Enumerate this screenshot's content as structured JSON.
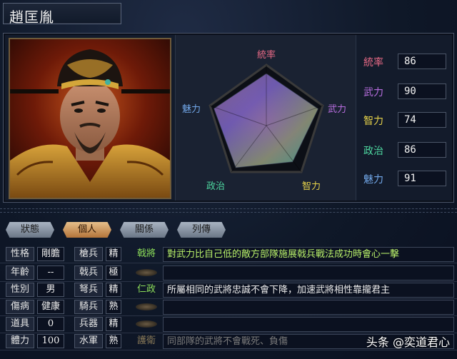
{
  "character": {
    "name": "趙匡胤"
  },
  "radar": {
    "labels": {
      "leadership": "統率",
      "war": "武力",
      "intelligence": "智力",
      "politics": "政治",
      "charisma": "魅力"
    }
  },
  "stats": [
    {
      "label": "統率",
      "value": "86",
      "color": "#e86a86"
    },
    {
      "label": "武力",
      "value": "90",
      "color": "#b96ee0"
    },
    {
      "label": "智力",
      "value": "74",
      "color": "#e6d24a"
    },
    {
      "label": "政治",
      "value": "86",
      "color": "#4ed8a0"
    },
    {
      "label": "魅力",
      "value": "91",
      "color": "#72a8ea"
    }
  ],
  "tabs": [
    {
      "label": "狀態",
      "active": false
    },
    {
      "label": "個人",
      "active": true
    },
    {
      "label": "關係",
      "active": false
    },
    {
      "label": "列傳",
      "active": false
    }
  ],
  "personal": [
    {
      "label": "性格",
      "value": "剛膽"
    },
    {
      "label": "年齡",
      "value": "--"
    },
    {
      "label": "性別",
      "value": "男"
    },
    {
      "label": "傷病",
      "value": "健康"
    },
    {
      "label": "道具",
      "value": "0"
    },
    {
      "label": "體力",
      "value": "100"
    }
  ],
  "aptitudes": [
    {
      "label": "槍兵",
      "value": "精"
    },
    {
      "label": "戟兵",
      "value": "極"
    },
    {
      "label": "弩兵",
      "value": "精"
    },
    {
      "label": "騎兵",
      "value": "熟"
    },
    {
      "label": "兵器",
      "value": "精"
    },
    {
      "label": "水軍",
      "value": "熟"
    }
  ],
  "tactics": [
    {
      "name": "戟將",
      "name_color": "#8ee05a",
      "desc": "對武力比自己低的敵方部隊施展戟兵戰法成功時會心一擊",
      "desc_color": "#b8f06a"
    },
    {
      "name": "",
      "name_color": "#8ee05a",
      "desc": "",
      "desc_color": "#e8e8e8"
    },
    {
      "name": "仁政",
      "name_color": "#8ee05a",
      "desc": "所屬相同的武將忠誠不會下降，加速武將相性靠攏君主",
      "desc_color": "#ececec"
    },
    {
      "name": "",
      "name_color": "#8ee05a",
      "desc": "",
      "desc_color": "#e8e8e8"
    },
    {
      "name": "",
      "name_color": "#8ee05a",
      "desc": "",
      "desc_color": "#e8e8e8"
    },
    {
      "name": "護衛",
      "name_color": "#8a7a58",
      "desc": "同部隊的武將不會戰死、負傷",
      "desc_color": "#7a7a7a"
    }
  ],
  "watermark": "头条 @奕道君心"
}
